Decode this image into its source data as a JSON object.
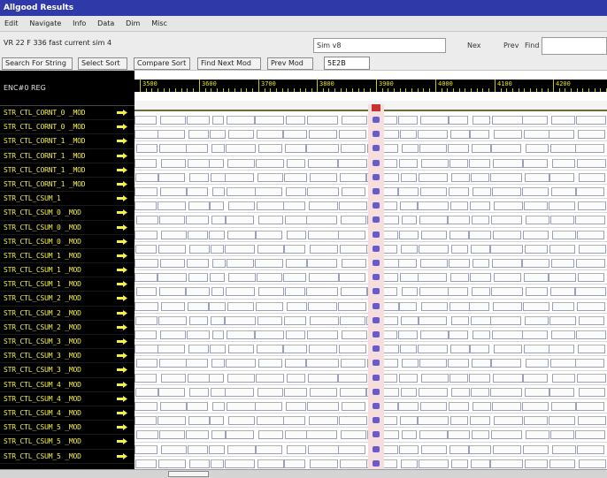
{
  "window": {
    "title": "Allgood Results"
  },
  "menu": [
    "Edit",
    "Navigate",
    "Info",
    "Data",
    "Dim",
    "Misc"
  ],
  "toolbar": {
    "path": "VR 22 F 336 fast current sim 4",
    "search_value": "Sim v8",
    "btn_next": "Nex",
    "btn_prev": "Prev",
    "find_label": "Find"
  },
  "toolbar2": {
    "btn_search_for_string": "Search For String",
    "btn_select_sort": "Select Sort",
    "btn_compare_sort": "Compare Sort",
    "btn_find_next_mod": "Find Next Mod",
    "btn_prev_mod": "Prev Mod",
    "value_display": "5E2B"
  },
  "signals": {
    "header": "ENC#0 REG",
    "rows": [
      "STR_CTL_CORNT_0 _MOD",
      "STR_CTL_CORNT_0 _MOD",
      "STR_CTL_CORNT_1 _MOD",
      "STR_CTL_CORNT_1 _MOD",
      "STR_CTL_CORNT_1 _MOD",
      "STR_CTL_CORNT_1 _MOD",
      "STR_CTL_CSUM_1",
      "STR_CTL_CSUM_0 _MOD",
      "STR_CTL_CSUM_0 _MOD",
      "STR_CTL_CSUM_0 _MOD",
      "STR_CTL_CSUM_1 _MOD",
      "STR_CTL_CSUM_1 _MOD",
      "STR_CTL_CSUM_1 _MOD",
      "STR_CTL_CSUM_2 _MOD",
      "STR_CTL_CSUM_2 _MOD",
      "STR_CTL_CSUM_2 _MOD",
      "STR_CTL_CSUM_3 _MOD",
      "STR_CTL_CSUM_3 _MOD",
      "STR_CTL_CSUM_3 _MOD",
      "STR_CTL_CSUM_4 _MOD",
      "STR_CTL_CSUM_4 _MOD",
      "STR_CTL_CSUM_4 _MOD",
      "STR_CTL_CSUM_5 _MOD",
      "STR_CTL_CSUM_5 _MOD",
      "STR_CTL_CSUM_5 _MOD"
    ]
  },
  "timeline": {
    "labels": [
      "3500",
      "3600",
      "3700",
      "3800",
      "3900",
      "4000",
      "4100",
      "4200"
    ]
  },
  "colors": {
    "signal_text": "#f2ee4a",
    "arrow": "#f2ee4a",
    "cursor_bg": "#f6dede",
    "cursor_mark": "#6a5acd"
  },
  "icons": {
    "row_arrow": "right-arrow-icon"
  }
}
